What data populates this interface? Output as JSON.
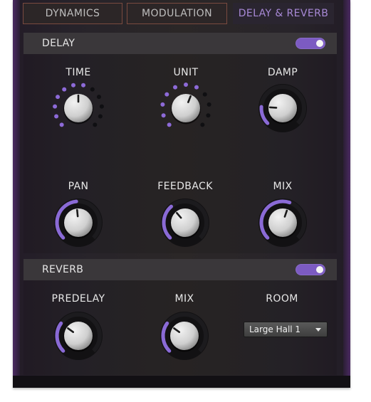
{
  "tabs": [
    {
      "label": "DYNAMICS",
      "active": false
    },
    {
      "label": "MODULATION",
      "active": false
    },
    {
      "label": "DELAY & REVERB",
      "active": true
    }
  ],
  "delay": {
    "title": "DELAY",
    "enabled": true,
    "knobs": {
      "time": {
        "label": "TIME",
        "style": "stepped",
        "steps": 12,
        "value_fraction": 0.5,
        "active_steps": 7
      },
      "unit": {
        "label": "UNIT",
        "style": "stepped",
        "steps": 11,
        "value_fraction": 0.58,
        "active_steps": 7
      },
      "damp": {
        "label": "DAMP",
        "style": "arc",
        "value_fraction": 0.18
      },
      "pan": {
        "label": "PAN",
        "style": "arc",
        "value_fraction": 0.48
      },
      "feedback": {
        "label": "FEEDBACK",
        "style": "arc",
        "value_fraction": 0.35
      },
      "mix": {
        "label": "MIX",
        "style": "arc",
        "value_fraction": 0.57
      }
    }
  },
  "reverb": {
    "title": "REVERB",
    "enabled": true,
    "knobs": {
      "predelay": {
        "label": "PREDELAY",
        "style": "arc",
        "value_fraction": 0.3
      },
      "mix": {
        "label": "MIX",
        "style": "arc",
        "value_fraction": 0.3
      }
    },
    "room": {
      "label": "ROOM",
      "selected": "Large Hall 1"
    }
  },
  "colors": {
    "accent": "#7c5bc2",
    "arc_active": "#8a6ad6",
    "dot_active": "#8d6ad8",
    "dot_inactive": "#0f0f12"
  }
}
